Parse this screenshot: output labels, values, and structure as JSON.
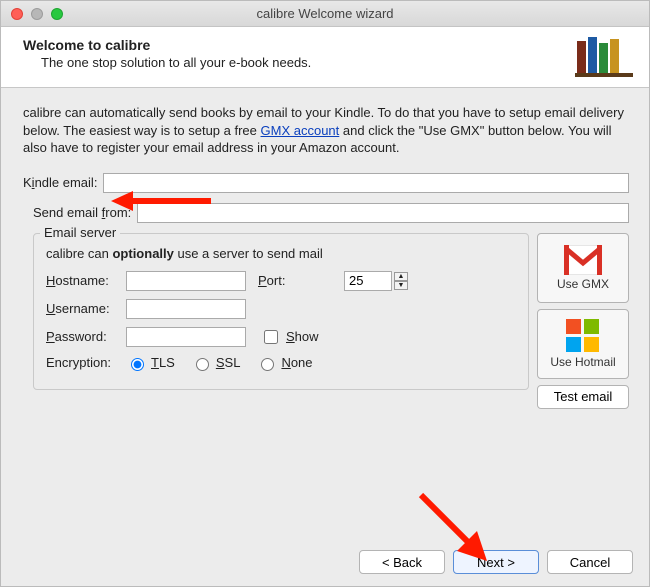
{
  "window": {
    "title": "calibre Welcome wizard"
  },
  "header": {
    "title": "Welcome to calibre",
    "subtitle": "The one stop solution to all your e-book needs."
  },
  "intro": {
    "pre": "calibre can automatically send books by email to your Kindle. To do that you have to setup email delivery below. The easiest way is to setup a free ",
    "link": "GMX account",
    "post": " and click the \"Use GMX\" button below. You will also have to register your email address in your Amazon account."
  },
  "fields": {
    "kindle_label_pre": "K",
    "kindle_label_u": "i",
    "kindle_label_post": "ndle email:",
    "kindle_value": "",
    "sendfrom_label_pre": "Send email ",
    "sendfrom_label_u": "f",
    "sendfrom_label_post": "rom:",
    "sendfrom_value": ""
  },
  "server": {
    "legend": "Email server",
    "note_pre": "calibre can ",
    "note_b": "optionally",
    "note_post": " use a server to send mail",
    "hostname_label_u": "H",
    "hostname_label_post": "ostname:",
    "hostname_value": "",
    "port_label_u": "P",
    "port_label_post": "ort:",
    "port_value": "25",
    "username_label_u": "U",
    "username_label_post": "sername:",
    "username_value": "",
    "password_label_u": "P",
    "password_label_post": "assword:",
    "password_value": "",
    "show_label_u": "S",
    "show_label_post": "how",
    "encryption_label": "Encryption:",
    "enc_tls_u": "T",
    "enc_tls_post": "LS",
    "enc_ssl_u": "S",
    "enc_ssl_post": "SL",
    "enc_none_u": "N",
    "enc_none_post": "one"
  },
  "side": {
    "gmx_label": "Use GMX",
    "hotmail_label": "Use Hotmail",
    "test_label": "Test email"
  },
  "footer": {
    "back": "< Back",
    "next": "Next >",
    "cancel": "Cancel"
  }
}
